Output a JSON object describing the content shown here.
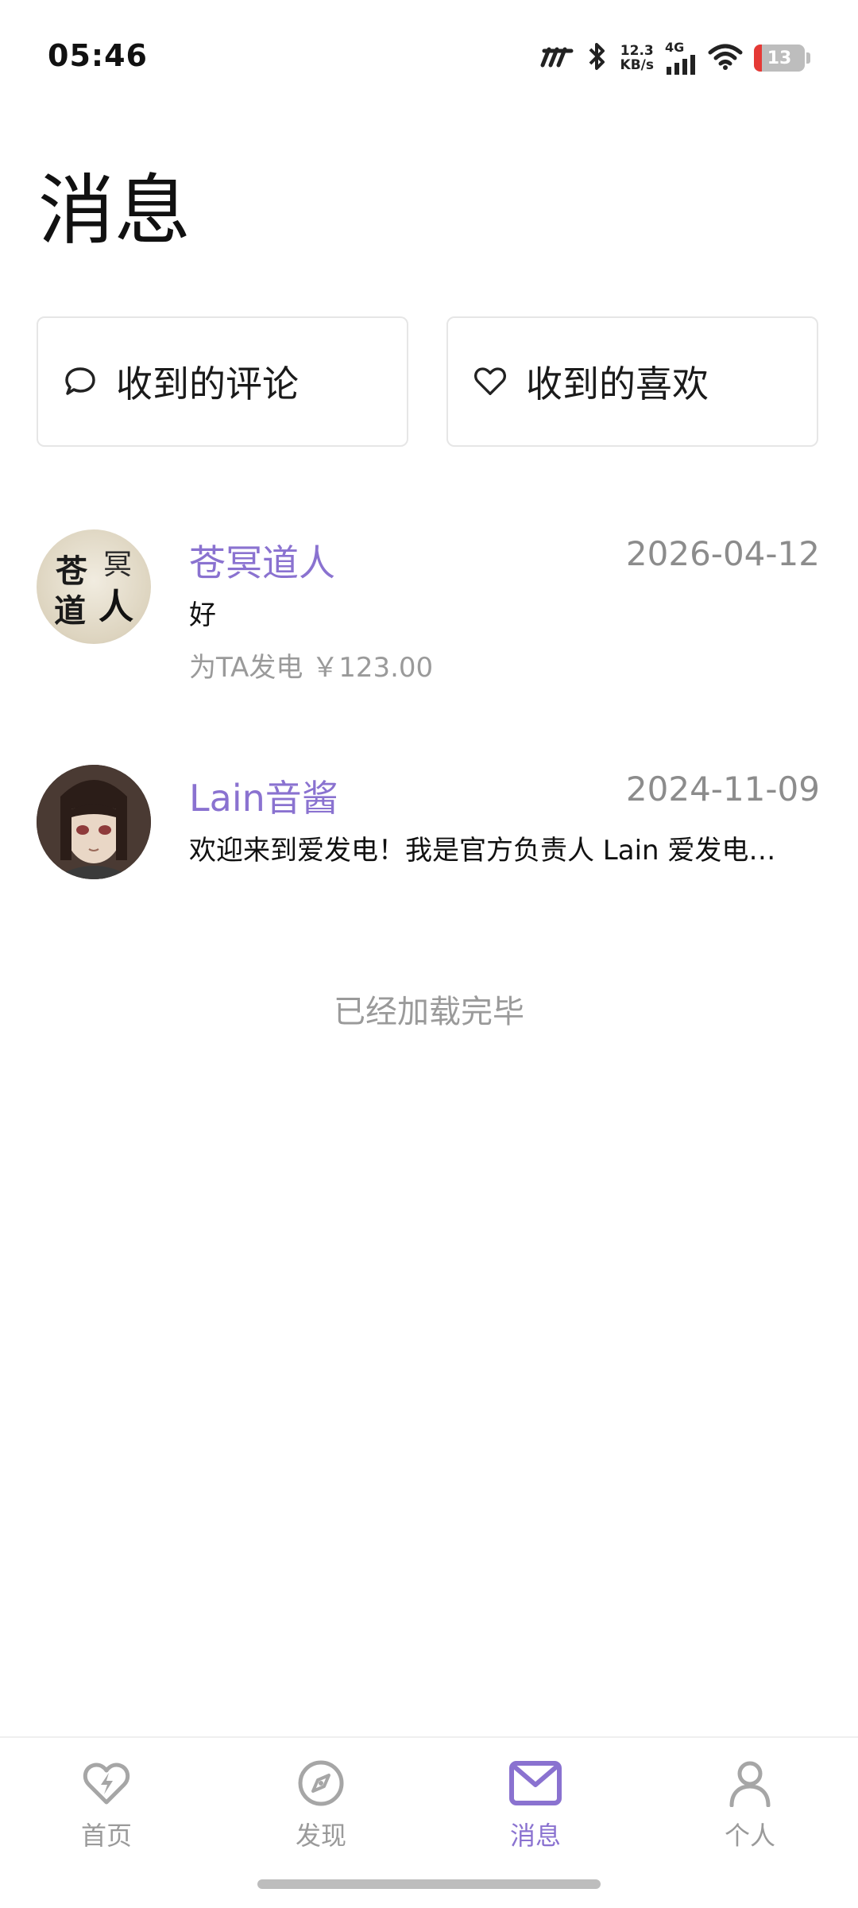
{
  "status_bar": {
    "time": "05:46",
    "net_speed_value": "12.3",
    "net_speed_unit": "KB/s",
    "network_type": "4G",
    "battery_level": "13",
    "icons": [
      "carrier-icon",
      "bluetooth-icon",
      "signal-icon",
      "wifi-icon",
      "battery-icon"
    ]
  },
  "page": {
    "title": "消息"
  },
  "cards": {
    "comments_label": "收到的评论",
    "comments_icon": "comment-bubble-icon",
    "likes_label": "收到的喜欢",
    "likes_icon": "heart-icon"
  },
  "messages": [
    {
      "name": "苍冥道人",
      "date": "2026-04-12",
      "text": "好",
      "sub": "为TA发电  ￥123.00",
      "avatar_text": [
        "苍",
        "冥",
        "道",
        "人"
      ]
    },
    {
      "name": "Lain音酱",
      "date": "2024-11-09",
      "text": "欢迎来到爱发电！我是官方负责人 Lain 爱发电…"
    }
  ],
  "loaded_hint": "已经加载完毕",
  "nav": {
    "items": [
      {
        "label": "首页",
        "icon": "heart-bolt-icon",
        "active": false
      },
      {
        "label": "发现",
        "icon": "compass-icon",
        "active": false
      },
      {
        "label": "消息",
        "icon": "mail-icon",
        "active": true
      },
      {
        "label": "个人",
        "icon": "person-icon",
        "active": false
      }
    ]
  },
  "colors": {
    "accent": "#8a72d0",
    "muted": "#9a9a9a"
  }
}
